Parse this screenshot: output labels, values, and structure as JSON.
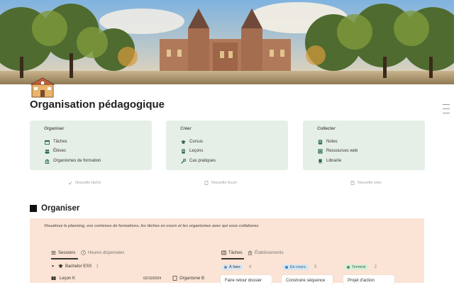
{
  "page": {
    "title": "Organisation pédagogique"
  },
  "cards": [
    {
      "title": "Organiser",
      "items": [
        {
          "icon": "calendar-icon",
          "label": "Tâches"
        },
        {
          "icon": "people-icon",
          "label": "Élèves"
        },
        {
          "icon": "institution-icon",
          "label": "Organismes de formation"
        }
      ]
    },
    {
      "title": "Créer",
      "items": [
        {
          "icon": "graduation-cap-icon",
          "label": "Cursus"
        },
        {
          "icon": "document-icon",
          "label": "Leçons"
        },
        {
          "icon": "wrench-icon",
          "label": "Cas pratiques"
        }
      ]
    },
    {
      "title": "Collecter",
      "items": [
        {
          "icon": "note-icon",
          "label": "Notes"
        },
        {
          "icon": "globe-icon",
          "label": "Ressources web"
        },
        {
          "icon": "book-icon",
          "label": "Librairie"
        }
      ]
    }
  ],
  "quick_actions": [
    {
      "icon": "check-icon",
      "label": "Nouvelle tâche"
    },
    {
      "icon": "document-icon",
      "label": "Nouvelle leçon"
    },
    {
      "icon": "note-icon",
      "label": "Nouvelle note"
    }
  ],
  "organiser": {
    "heading": "Organiser",
    "description": "Visualisez le planning, vos contenus de formations, les tâches en cours et les organismes avec qui vous collaborez.",
    "left_tabs": [
      {
        "icon": "list-icon",
        "label": "Sessions",
        "active": true
      },
      {
        "icon": "clock-icon",
        "label": "Heures dispensées",
        "active": false
      }
    ],
    "group": {
      "label": "Bachelor ESS",
      "count": "1"
    },
    "row": {
      "label": "Leçon K",
      "date": "02/10/2024",
      "organisme": "Organisme B"
    },
    "right_tabs": [
      {
        "icon": "board-icon",
        "label": "Tâches",
        "active": true
      },
      {
        "icon": "institution-icon",
        "label": "Établissements",
        "active": false
      }
    ],
    "board": [
      {
        "status": "À faire",
        "count": "4",
        "card": "Faire retour dossier",
        "color": "#dbe6f3",
        "dot": "#7a8fa8",
        "text": "#37352f"
      },
      {
        "status": "En cours",
        "count": "3",
        "card": "Construire séquence",
        "color": "#d3e5f1",
        "dot": "#3b83bd",
        "text": "#1f5a86"
      },
      {
        "status": "Terminé",
        "count": "2",
        "card": "Projet d'action",
        "color": "#dbeddb",
        "dot": "#4b9358",
        "text": "#2f6b3a"
      }
    ]
  },
  "colors": {
    "callout_green": "#e6efe7",
    "callout_orange": "#fbe4d5"
  }
}
